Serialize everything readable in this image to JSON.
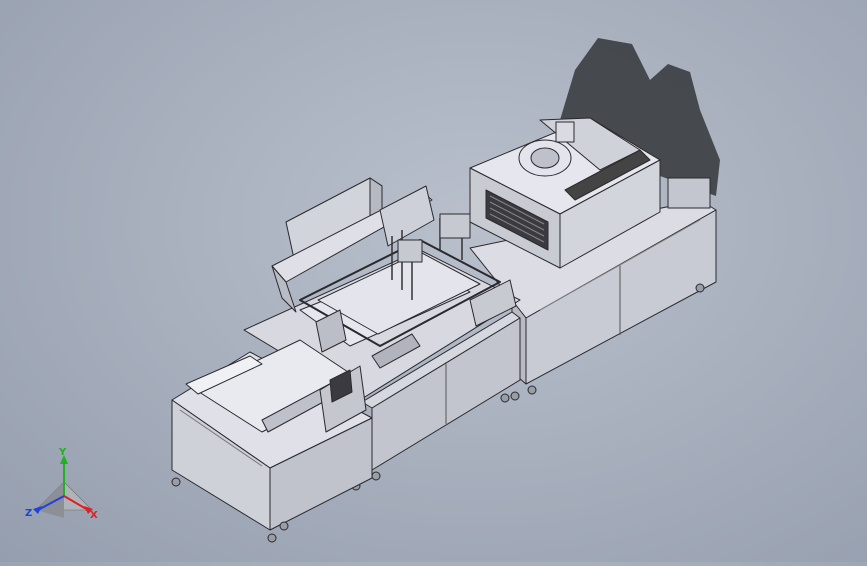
{
  "viewport": {
    "background_top": "#b9c0cc",
    "background_bottom": "#959eae",
    "model_face": "#d9dbe3",
    "model_edge": "#2a2a2e",
    "shadow": "#2f3135"
  },
  "triad": {
    "x_label": "X",
    "y_label": "Y",
    "z_label": "Z",
    "x_color": "#e02020",
    "y_color": "#20b020",
    "z_color": "#2040e0"
  }
}
